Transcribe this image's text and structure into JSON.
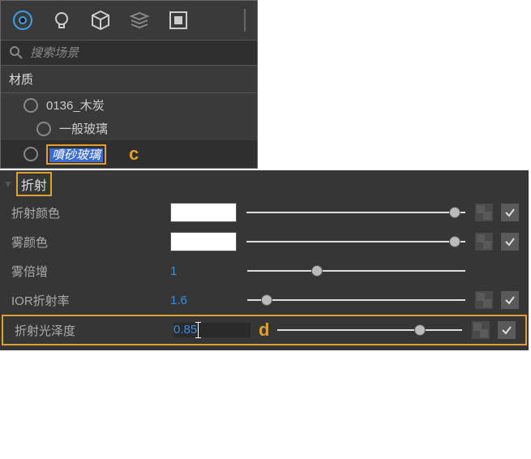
{
  "top": {
    "search_placeholder": "搜索场景",
    "section_title": "材质",
    "materials": [
      {
        "name": "0136_木炭"
      },
      {
        "name": "一般玻璃"
      },
      {
        "name": "噴砂玻璃",
        "selected": true
      }
    ],
    "annot_c": "c"
  },
  "refraction": {
    "title": "折射",
    "rows": {
      "color": {
        "label": "折射颜色",
        "swatch": "#ffffff",
        "slider": 0.95
      },
      "fog": {
        "label": "雾颜色",
        "swatch": "#ffffff",
        "slider": 0.95
      },
      "fogmult": {
        "label": "雾倍增",
        "value": "1",
        "slider": 0.32
      },
      "ior": {
        "label": "IOR折射率",
        "value": "1.6",
        "slider": 0.09
      },
      "gloss": {
        "label": "折射光泽度",
        "value": "0.85",
        "slider": 0.77
      }
    },
    "annot_d": "d"
  }
}
